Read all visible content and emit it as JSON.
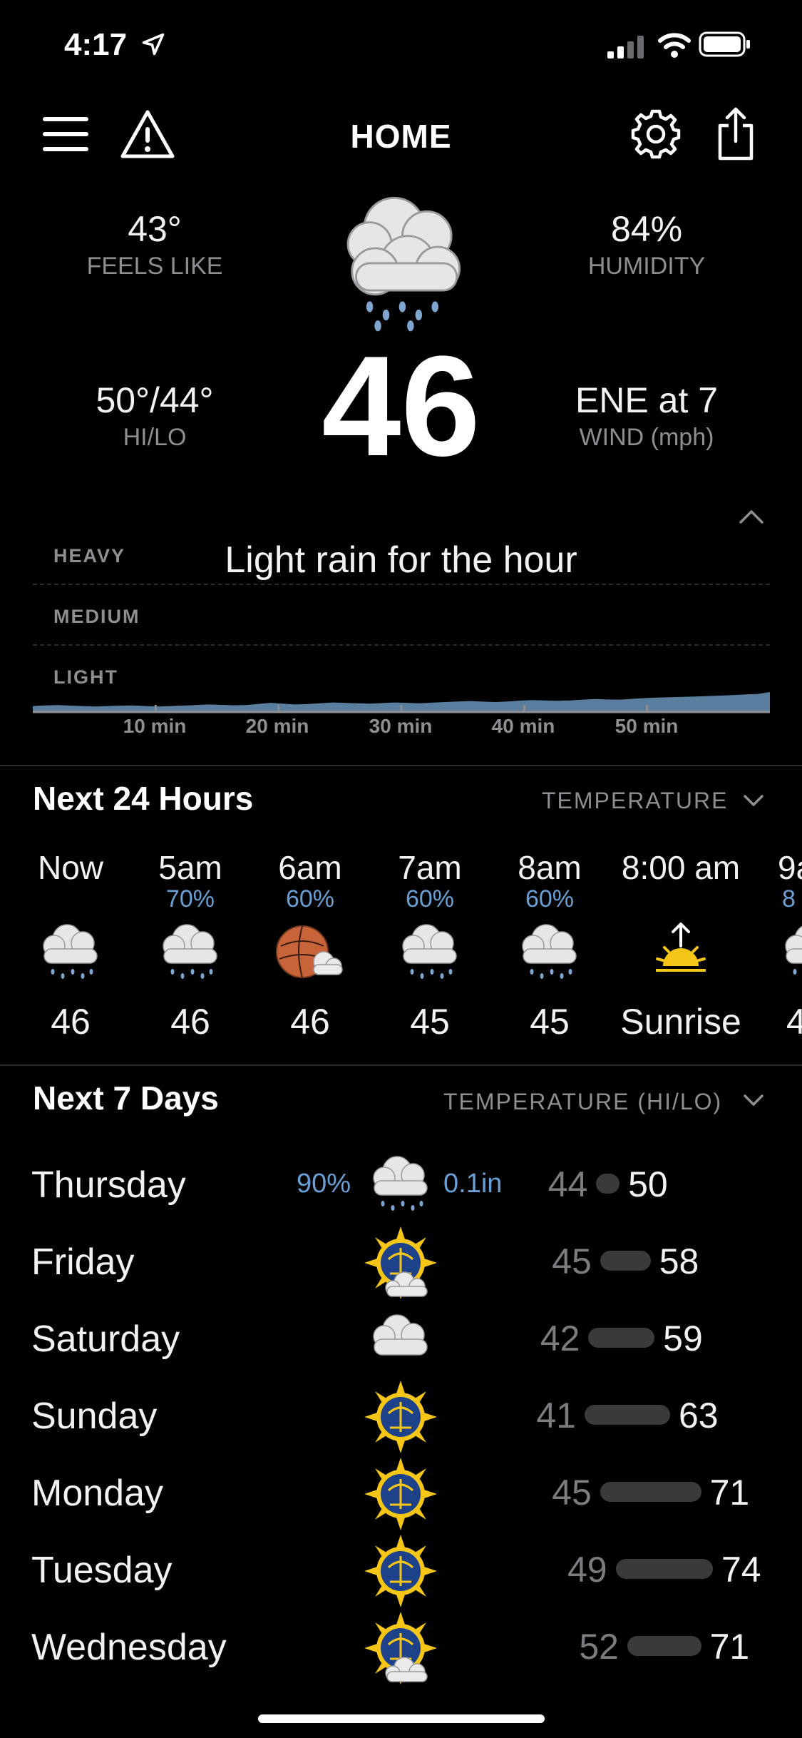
{
  "status_bar": {
    "time": "4:17"
  },
  "header": {
    "title": "HOME"
  },
  "current": {
    "feels_like": {
      "value": "43°",
      "label": "FEELS LIKE"
    },
    "humidity": {
      "value": "84%",
      "label": "HUMIDITY"
    },
    "hilo": {
      "value": "50°/44°",
      "label": "HI/LO"
    },
    "temp": "46",
    "wind": {
      "value": "ENE at 7",
      "label": "WIND (mph)"
    },
    "icon": "rain-cloud-icon"
  },
  "precip": {
    "summary": "Light rain for the hour",
    "levels": [
      "HEAVY",
      "MEDIUM",
      "LIGHT"
    ],
    "ticks": [
      "10 min",
      "20 min",
      "30 min",
      "40 min",
      "50 min"
    ],
    "intensity": [
      0.3,
      0.33,
      0.35,
      0.32,
      0.3,
      0.28,
      0.3,
      0.32,
      0.33,
      0.3,
      0.28,
      0.3,
      0.32,
      0.35,
      0.38,
      0.36,
      0.34,
      0.35,
      0.4,
      0.46,
      0.42,
      0.38,
      0.4,
      0.44,
      0.48,
      0.46,
      0.44,
      0.42,
      0.45,
      0.48,
      0.46,
      0.44,
      0.47,
      0.5,
      0.53,
      0.55,
      0.52,
      0.5,
      0.53,
      0.57,
      0.6,
      0.58,
      0.56,
      0.58,
      0.62,
      0.65,
      0.63,
      0.62,
      0.66,
      0.7,
      0.72,
      0.74,
      0.76,
      0.78,
      0.8,
      0.82,
      0.85,
      0.88,
      0.9,
      1.0
    ]
  },
  "hourly": {
    "title": "Next 24 Hours",
    "selector": "TEMPERATURE",
    "items": [
      {
        "label": "Now",
        "pct": "",
        "icon": "rain-cloud-icon",
        "temp": "46"
      },
      {
        "label": "5am",
        "pct": "70%",
        "icon": "rain-cloud-icon",
        "temp": "46"
      },
      {
        "label": "6am",
        "pct": "60%",
        "icon": "night-rain-moon-icon",
        "temp": "46"
      },
      {
        "label": "7am",
        "pct": "60%",
        "icon": "rain-cloud-icon",
        "temp": "45"
      },
      {
        "label": "8am",
        "pct": "60%",
        "icon": "rain-cloud-icon",
        "temp": "45"
      },
      {
        "label": "8:00 am",
        "pct": "",
        "icon": "sunrise-icon",
        "temp": "Sunrise"
      },
      {
        "label": "9a",
        "pct": "8",
        "icon": "rain-cloud-icon",
        "temp": "4"
      }
    ]
  },
  "daily": {
    "title": "Next 7 Days",
    "selector": "TEMPERATURE (HI/LO)",
    "scale_min": 41,
    "scale_max": 74,
    "days": [
      {
        "name": "Thursday",
        "pct": "90%",
        "amount": "0.1in",
        "icon": "rain-cloud-icon",
        "lo": 44,
        "hi": 50
      },
      {
        "name": "Friday",
        "pct": "",
        "amount": "",
        "icon": "sun-cloud-icon",
        "lo": 45,
        "hi": 58
      },
      {
        "name": "Saturday",
        "pct": "",
        "amount": "",
        "icon": "cloud-icon",
        "lo": 42,
        "hi": 59
      },
      {
        "name": "Sunday",
        "pct": "",
        "amount": "",
        "icon": "sun-icon",
        "lo": 41,
        "hi": 63
      },
      {
        "name": "Monday",
        "pct": "",
        "amount": "",
        "icon": "sun-icon",
        "lo": 45,
        "hi": 71
      },
      {
        "name": "Tuesday",
        "pct": "",
        "amount": "",
        "icon": "sun-icon",
        "lo": 49,
        "hi": 74
      },
      {
        "name": "Wednesday",
        "pct": "",
        "amount": "",
        "icon": "sun-cloud-icon",
        "lo": 52,
        "hi": 71
      }
    ]
  },
  "colors": {
    "accent": "#6a9fd4",
    "chart_fill": "#5a7f9e",
    "bar": "#3a3a3c",
    "sun": "#f5c518"
  }
}
